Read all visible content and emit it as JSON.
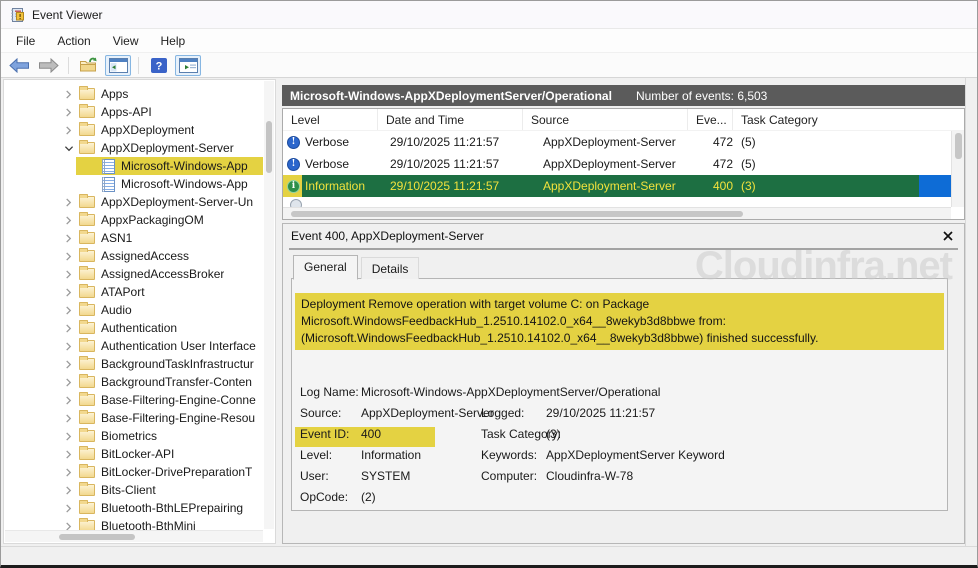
{
  "window": {
    "title": "Event Viewer"
  },
  "menu": {
    "items": [
      "File",
      "Action",
      "View",
      "Help"
    ]
  },
  "toolbar": {
    "buttons": [
      "back",
      "forward",
      "export-folder",
      "show-console-tree",
      "help",
      "show-action-pane"
    ]
  },
  "tree": {
    "items": [
      {
        "label": "Apps",
        "kind": "folder",
        "chevron": "collapsed",
        "indent": 0,
        "highlight": false
      },
      {
        "label": "Apps-API",
        "kind": "folder",
        "chevron": "collapsed",
        "indent": 0,
        "highlight": false
      },
      {
        "label": "AppXDeployment",
        "kind": "folder",
        "chevron": "collapsed",
        "indent": 0,
        "highlight": false
      },
      {
        "label": "AppXDeployment-Server",
        "kind": "folder",
        "chevron": "expanded",
        "indent": 0,
        "highlight": false
      },
      {
        "label": "Microsoft-Windows-App",
        "kind": "log",
        "chevron": "none",
        "indent": 1,
        "highlight": true
      },
      {
        "label": "Microsoft-Windows-App",
        "kind": "log",
        "chevron": "none",
        "indent": 1,
        "highlight": false
      },
      {
        "label": "AppXDeployment-Server-Un",
        "kind": "folder",
        "chevron": "collapsed",
        "indent": 0,
        "highlight": false
      },
      {
        "label": "AppxPackagingOM",
        "kind": "folder",
        "chevron": "collapsed",
        "indent": 0,
        "highlight": false
      },
      {
        "label": "ASN1",
        "kind": "folder",
        "chevron": "collapsed",
        "indent": 0,
        "highlight": false
      },
      {
        "label": "AssignedAccess",
        "kind": "folder",
        "chevron": "collapsed",
        "indent": 0,
        "highlight": false
      },
      {
        "label": "AssignedAccessBroker",
        "kind": "folder",
        "chevron": "collapsed",
        "indent": 0,
        "highlight": false
      },
      {
        "label": "ATAPort",
        "kind": "folder",
        "chevron": "collapsed",
        "indent": 0,
        "highlight": false
      },
      {
        "label": "Audio",
        "kind": "folder",
        "chevron": "collapsed",
        "indent": 0,
        "highlight": false
      },
      {
        "label": "Authentication",
        "kind": "folder",
        "chevron": "collapsed",
        "indent": 0,
        "highlight": false
      },
      {
        "label": "Authentication User Interface",
        "kind": "folder",
        "chevron": "collapsed",
        "indent": 0,
        "highlight": false
      },
      {
        "label": "BackgroundTaskInfrastructur",
        "kind": "folder",
        "chevron": "collapsed",
        "indent": 0,
        "highlight": false
      },
      {
        "label": "BackgroundTransfer-Conten",
        "kind": "folder",
        "chevron": "collapsed",
        "indent": 0,
        "highlight": false
      },
      {
        "label": "Base-Filtering-Engine-Conne",
        "kind": "folder",
        "chevron": "collapsed",
        "indent": 0,
        "highlight": false
      },
      {
        "label": "Base-Filtering-Engine-Resou",
        "kind": "folder",
        "chevron": "collapsed",
        "indent": 0,
        "highlight": false
      },
      {
        "label": "Biometrics",
        "kind": "folder",
        "chevron": "collapsed",
        "indent": 0,
        "highlight": false
      },
      {
        "label": "BitLocker-API",
        "kind": "folder",
        "chevron": "collapsed",
        "indent": 0,
        "highlight": false
      },
      {
        "label": "BitLocker-DrivePreparationT",
        "kind": "folder",
        "chevron": "collapsed",
        "indent": 0,
        "highlight": false
      },
      {
        "label": "Bits-Client",
        "kind": "folder",
        "chevron": "collapsed",
        "indent": 0,
        "highlight": false
      },
      {
        "label": "Bluetooth-BthLEPrepairing",
        "kind": "folder",
        "chevron": "collapsed",
        "indent": 0,
        "highlight": false
      },
      {
        "label": "Bluetooth-BthMini",
        "kind": "folder",
        "chevron": "collapsed",
        "indent": 0,
        "highlight": false
      }
    ]
  },
  "list": {
    "header_title": "Microsoft-Windows-AppXDeploymentServer/Operational",
    "header_count": "Number of events: 6,503",
    "columns": [
      "Level",
      "Date and Time",
      "Source",
      "Eve...",
      "Task Category"
    ],
    "rows": [
      {
        "level": "Verbose",
        "date": "29/10/2025 11:21:57",
        "source": "AppXDeployment-Server",
        "event_id": "472",
        "task": "(5)",
        "selected": false
      },
      {
        "level": "Verbose",
        "date": "29/10/2025 11:21:57",
        "source": "AppXDeployment-Server",
        "event_id": "472",
        "task": "(5)",
        "selected": false
      },
      {
        "level": "Information",
        "date": "29/10/2025 11:21:57",
        "source": "AppXDeployment-Server",
        "event_id": "400",
        "task": "(3)",
        "selected": true
      }
    ]
  },
  "detail": {
    "title": "Event 400, AppXDeployment-Server",
    "tabs": [
      "General",
      "Details"
    ],
    "active_tab": "General",
    "description": "Deployment Remove operation with target volume C: on Package Microsoft.WindowsFeedbackHub_1.2510.14102.0_x64__8wekyb3d8bbwe from:  (Microsoft.WindowsFeedbackHub_1.2510.14102.0_x64__8wekyb3d8bbwe)  finished successfully.",
    "fields": {
      "log_name_label": "Log Name:",
      "log_name": "Microsoft-Windows-AppXDeploymentServer/Operational",
      "source_label": "Source:",
      "source": "AppXDeployment-Server",
      "logged_label": "Logged:",
      "logged": "29/10/2025 11:21:57",
      "event_id_label": "Event ID:",
      "event_id": "400",
      "task_category_label": "Task Category:",
      "task_category": "(3)",
      "level_label": "Level:",
      "level": "Information",
      "keywords_label": "Keywords:",
      "keywords": "AppXDeploymentServer Keyword",
      "user_label": "User:",
      "user": "SYSTEM",
      "computer_label": "Computer:",
      "computer": "Cloudinfra-W-78",
      "opcode_label": "OpCode:",
      "opcode": "(2)"
    }
  },
  "watermark": "Cloudinfra.net",
  "colors": {
    "highlight_yellow": "#e4d242",
    "highlight_green": "#1d6f42",
    "selection_blue": "#0e6cd6",
    "header_gray": "#5b5b5b",
    "verbose_icon": "#2b66cc",
    "information_icon": "#2e8f4a"
  }
}
